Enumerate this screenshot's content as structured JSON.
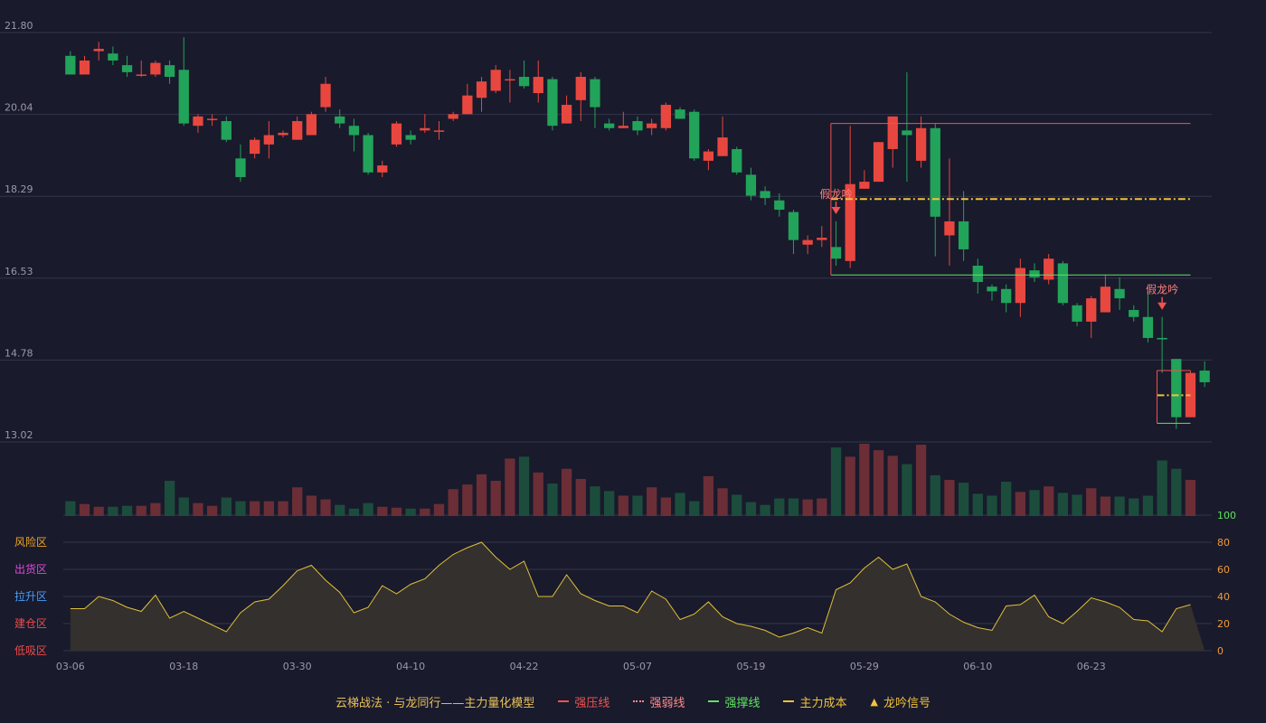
{
  "chart_data": {
    "type": "candlestick",
    "y_ticks": [
      "21.80",
      "20.04",
      "18.29",
      "16.53",
      "14.78",
      "13.02"
    ],
    "ylim": [
      13.02,
      21.8
    ],
    "x_tick_labels": [
      {
        "i": 0,
        "label": "03-06"
      },
      {
        "i": 8,
        "label": "03-18"
      },
      {
        "i": 16,
        "label": "03-30"
      },
      {
        "i": 24,
        "label": "04-10"
      },
      {
        "i": 32,
        "label": "04-22"
      },
      {
        "i": 40,
        "label": "05-07"
      },
      {
        "i": 48,
        "label": "05-19"
      },
      {
        "i": 56,
        "label": "05-29"
      },
      {
        "i": 64,
        "label": "06-10"
      },
      {
        "i": 72,
        "label": "06-23"
      }
    ],
    "candles": [
      [
        21.3,
        20.9,
        21.4,
        20.9
      ],
      [
        20.9,
        21.2,
        21.3,
        20.9
      ],
      [
        21.4,
        21.45,
        21.6,
        21.2
      ],
      [
        21.35,
        21.2,
        21.5,
        21.1
      ],
      [
        21.1,
        20.95,
        21.3,
        20.85
      ],
      [
        20.9,
        20.9,
        21.2,
        20.85
      ],
      [
        20.9,
        21.15,
        21.2,
        20.85
      ],
      [
        21.1,
        20.85,
        21.2,
        20.7
      ],
      [
        21.0,
        19.85,
        21.7,
        19.8
      ],
      [
        19.8,
        20.0,
        20.05,
        19.65
      ],
      [
        19.95,
        19.95,
        20.05,
        19.8
      ],
      [
        19.9,
        19.5,
        20.0,
        19.45
      ],
      [
        19.1,
        18.7,
        19.4,
        18.6
      ],
      [
        19.2,
        19.5,
        19.55,
        19.1
      ],
      [
        19.4,
        19.6,
        19.9,
        19.1
      ],
      [
        19.6,
        19.65,
        19.7,
        19.55
      ],
      [
        19.5,
        19.9,
        20.0,
        19.5
      ],
      [
        19.6,
        20.05,
        20.1,
        19.6
      ],
      [
        20.2,
        20.7,
        20.85,
        20.1
      ],
      [
        20.0,
        19.85,
        20.15,
        19.75
      ],
      [
        19.8,
        19.6,
        19.95,
        19.25
      ],
      [
        19.6,
        18.8,
        19.65,
        18.75
      ],
      [
        18.8,
        18.95,
        19.05,
        18.7
      ],
      [
        19.4,
        19.85,
        19.9,
        19.35
      ],
      [
        19.6,
        19.5,
        19.7,
        19.4
      ],
      [
        19.7,
        19.75,
        20.05,
        19.65
      ],
      [
        19.7,
        19.7,
        19.9,
        19.5
      ],
      [
        19.95,
        20.05,
        20.1,
        19.9
      ],
      [
        20.05,
        20.45,
        20.7,
        20.05
      ],
      [
        20.4,
        20.75,
        20.85,
        20.1
      ],
      [
        20.55,
        21.0,
        21.1,
        20.5
      ],
      [
        20.8,
        20.8,
        21.0,
        20.3
      ],
      [
        20.85,
        20.65,
        21.2,
        20.6
      ],
      [
        20.5,
        20.85,
        21.2,
        20.3
      ],
      [
        20.8,
        19.8,
        20.85,
        19.7
      ],
      [
        19.85,
        20.25,
        20.45,
        19.85
      ],
      [
        20.35,
        20.85,
        20.95,
        19.9
      ],
      [
        20.8,
        20.2,
        20.85,
        19.75
      ],
      [
        19.85,
        19.75,
        19.95,
        19.7
      ],
      [
        19.75,
        19.8,
        20.1,
        19.75
      ],
      [
        19.9,
        19.7,
        20.0,
        19.6
      ],
      [
        19.75,
        19.85,
        19.95,
        19.6
      ],
      [
        19.75,
        20.25,
        20.3,
        19.7
      ],
      [
        20.15,
        19.95,
        20.2,
        19.95
      ],
      [
        20.1,
        19.1,
        20.15,
        19.05
      ],
      [
        19.05,
        19.25,
        19.3,
        18.85
      ],
      [
        19.15,
        19.55,
        20.0,
        19.15
      ],
      [
        19.3,
        18.8,
        19.35,
        18.75
      ],
      [
        18.75,
        18.3,
        18.9,
        18.2
      ],
      [
        18.4,
        18.25,
        18.5,
        18.1
      ],
      [
        18.2,
        18.0,
        18.35,
        17.85
      ],
      [
        17.95,
        17.35,
        18.0,
        17.05
      ],
      [
        17.25,
        17.35,
        17.45,
        17.05
      ],
      [
        17.35,
        17.4,
        17.65,
        17.2
      ],
      [
        17.2,
        16.95,
        17.75,
        16.8
      ],
      [
        16.9,
        18.55,
        19.8,
        16.75
      ],
      [
        18.45,
        18.6,
        18.85,
        18.45
      ],
      [
        18.6,
        19.45,
        19.45,
        18.6
      ],
      [
        19.3,
        20.0,
        20.0,
        18.9
      ],
      [
        19.7,
        19.6,
        20.95,
        18.6
      ],
      [
        19.05,
        19.75,
        20.0,
        18.9
      ],
      [
        19.75,
        17.85,
        19.85,
        17.0
      ],
      [
        17.45,
        17.75,
        19.1,
        16.8
      ],
      [
        17.75,
        17.15,
        18.4,
        16.9
      ],
      [
        16.8,
        16.45,
        16.95,
        16.2
      ],
      [
        16.35,
        16.25,
        16.4,
        16.05
      ],
      [
        16.3,
        16.0,
        16.4,
        15.8
      ],
      [
        16.0,
        16.75,
        16.95,
        15.7
      ],
      [
        16.7,
        16.55,
        16.85,
        16.45
      ],
      [
        16.5,
        16.95,
        17.05,
        16.4
      ],
      [
        16.85,
        16.0,
        16.9,
        15.95
      ],
      [
        15.95,
        15.6,
        16.0,
        15.5
      ],
      [
        15.6,
        16.1,
        16.15,
        15.25
      ],
      [
        15.8,
        16.35,
        16.6,
        15.8
      ],
      [
        16.3,
        16.1,
        16.55,
        15.85
      ],
      [
        15.85,
        15.7,
        15.95,
        15.6
      ],
      [
        15.7,
        15.25,
        16.25,
        15.15
      ],
      [
        15.25,
        15.22,
        15.7,
        14.5
      ],
      [
        14.8,
        13.55,
        14.8,
        13.3
      ],
      [
        13.55,
        14.5,
        14.55,
        13.55
      ],
      [
        14.55,
        14.3,
        14.75,
        14.2
      ]
    ],
    "volumes": [
      16,
      13,
      10,
      10,
      11,
      11,
      14,
      38,
      20,
      14,
      11,
      20,
      16,
      16,
      16,
      16,
      31,
      22,
      18,
      12,
      8,
      14,
      10,
      9,
      8,
      8,
      13,
      29,
      34,
      45,
      38,
      62,
      64,
      47,
      35,
      51,
      40,
      32,
      27,
      22,
      22,
      31,
      20,
      25,
      16,
      43,
      30,
      23,
      15,
      12,
      19,
      19,
      18,
      19,
      74,
      64,
      78,
      71,
      65,
      56,
      77,
      44,
      39,
      36,
      24,
      22,
      37,
      26,
      28,
      32,
      25,
      23,
      30,
      21,
      21,
      19,
      22,
      60,
      51,
      39
    ],
    "cost": [
      31,
      31,
      40,
      37,
      32,
      29,
      41,
      24,
      29,
      24,
      19,
      14,
      28,
      36,
      38,
      48,
      59,
      63,
      52,
      43,
      28,
      32,
      48,
      42,
      49,
      53,
      63,
      71,
      76,
      80,
      69,
      60,
      66,
      40,
      40,
      56,
      42,
      37,
      33,
      33,
      28,
      44,
      38,
      23,
      27,
      36,
      25,
      20,
      18,
      15,
      10,
      13,
      17,
      13,
      45,
      50,
      61,
      69,
      60,
      64,
      40,
      36,
      27,
      21,
      17,
      15,
      33,
      34,
      41,
      25,
      20,
      29,
      39,
      36,
      32,
      23,
      22,
      14,
      31,
      34
    ],
    "sub_y_ticks": [
      "100",
      "80",
      "60",
      "40",
      "20",
      "0"
    ],
    "zones": [
      {
        "label": "风险区",
        "color": "#f0a623"
      },
      {
        "label": "出货区",
        "color": "#dc4bd8"
      },
      {
        "label": "拉升区",
        "color": "#4a9df5"
      },
      {
        "label": "建仓区",
        "color": "#ef4a4a"
      },
      {
        "label": "低吸区",
        "color": "#ef4a4a"
      }
    ],
    "signals": [
      {
        "i": 54,
        "label": "假龙吟"
      },
      {
        "i": 77,
        "label": "假龙吟"
      }
    ],
    "levels": [
      {
        "kind": "resist",
        "from": 54,
        "to": 79,
        "price": 19.85
      },
      {
        "kind": "cost",
        "from": 54,
        "to": 79,
        "price": 18.23
      },
      {
        "kind": "support",
        "from": 54,
        "to": 79,
        "price": 16.6
      },
      {
        "kind": "resist",
        "from": 77,
        "to": 79,
        "price": 14.55
      },
      {
        "kind": "cost",
        "from": 77,
        "to": 79,
        "price": 14.02
      },
      {
        "kind": "support",
        "from": 77,
        "to": 79,
        "price": 13.42
      }
    ],
    "colors": {
      "up": "#e8473f",
      "down": "#22a35a",
      "up_vol": "#6b2e36",
      "down_vol": "#1c4d3c",
      "grid": "#33354a",
      "axis_text": "#9a9aa8",
      "resist": "#ef5350",
      "support": "#5fe35f",
      "cost": "#f2c23a",
      "sub_line": "#e0bf3a",
      "sub_fill": "#35312d",
      "sub_tick": "#f09a3a",
      "sub_tick_top": "#5fe35f"
    }
  },
  "legend": {
    "title": "云梯战法 · 与龙同行——主力量化模型",
    "items": [
      {
        "label": "强压线",
        "color": "#ef5350",
        "style": "solid"
      },
      {
        "label": "强弱线",
        "color": "#ff8a8a",
        "style": "dotted"
      },
      {
        "label": "强撑线",
        "color": "#5fe35f",
        "style": "solid"
      },
      {
        "label": "主力成本",
        "color": "#f2c23a",
        "style": "dashed"
      },
      {
        "label": "龙吟信号",
        "color": "#f2c23a",
        "style": "triangle"
      }
    ]
  }
}
